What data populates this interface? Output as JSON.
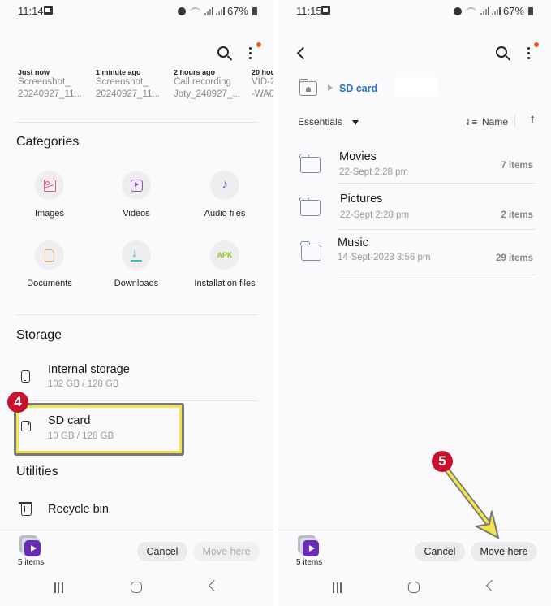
{
  "left": {
    "status": {
      "time": "11:14",
      "battery": "67%"
    },
    "recent": [
      {
        "when": "Just now",
        "name": "Screenshot_",
        "sub": "20240927_11..."
      },
      {
        "when": "1 minute ago",
        "name": "Screenshot_",
        "sub": "20240927_11..."
      },
      {
        "when": "2 hours ago",
        "name": "Call recording",
        "sub": "Joty_240927_..."
      },
      {
        "when": "20 hou",
        "name": "VID-2",
        "sub": "-WA0"
      }
    ],
    "categories_title": "Categories",
    "categories": [
      {
        "label": "Images",
        "icon": "image-icon"
      },
      {
        "label": "Videos",
        "icon": "video-icon"
      },
      {
        "label": "Audio files",
        "icon": "music-note-icon"
      },
      {
        "label": "Documents",
        "icon": "document-icon"
      },
      {
        "label": "Downloads",
        "icon": "download-icon"
      },
      {
        "label": "Installation files",
        "icon": "apk-icon",
        "glyph": "APK"
      }
    ],
    "storage_title": "Storage",
    "storage": [
      {
        "title": "Internal storage",
        "sub": "102 GB / 128 GB"
      },
      {
        "title": "SD card",
        "sub": "10 GB / 128 GB"
      }
    ],
    "utilities_title": "Utilities",
    "utilities": [
      {
        "title": "Recycle bin"
      }
    ],
    "step_badge": "4",
    "bottom": {
      "items": "5 items",
      "cancel": "Cancel",
      "move": "Move here"
    }
  },
  "right": {
    "status": {
      "time": "11:15",
      "battery": "67%"
    },
    "breadcrumb": {
      "current": "SD card"
    },
    "filter": "Essentials",
    "sort": "Name",
    "sort_direction": "↑",
    "folders": [
      {
        "name": "Movies",
        "date": "22-Sept 2:28 pm",
        "count": "7 items"
      },
      {
        "name": "Pictures",
        "date": "22-Sept 2:28 pm",
        "count": "2 items"
      },
      {
        "name": "Music",
        "date": "14-Sept-2023 3:56 pm",
        "count": "29 items"
      }
    ],
    "step_badge": "5",
    "bottom": {
      "items": "5 items",
      "cancel": "Cancel",
      "move": "Move here"
    }
  },
  "colors": {
    "highlight": "#f2e449",
    "badge": "#c8102e",
    "link": "#2a6fd0",
    "notification": "#e85a1b"
  }
}
